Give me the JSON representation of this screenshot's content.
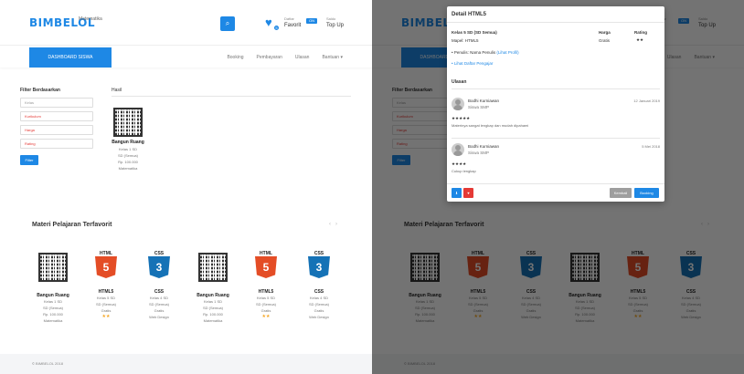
{
  "brand": "BIMBELOL",
  "header": {
    "search_value": "Matematika",
    "fav_label": "Daftar",
    "fav_value": "Favorit",
    "fav_count": "5",
    "toggle_label": "ON",
    "topup_label": "Saldo",
    "topup_value": "Top Up"
  },
  "nav": {
    "dashboard": "DASHBOARD SISWA",
    "items": [
      "Booking",
      "Pembayaran",
      "Ulasan",
      "Bantuan"
    ]
  },
  "filter": {
    "title": "Filter Berdasarkan",
    "fields": [
      "Kelas",
      "Kurikulum",
      "Harga",
      "Rating"
    ],
    "button": "Filter"
  },
  "results": {
    "title": "Hasil",
    "product": {
      "title": "Bangun Ruang",
      "meta": [
        "Kelas 1 SD",
        "SD (Semua)",
        "Rp. 100.000",
        "Matematika"
      ]
    }
  },
  "section": {
    "title": "Materi Pelajaran Terfavorit",
    "cards": [
      {
        "icon": "qr",
        "title": "Bangun Ruang",
        "meta": [
          "Kelas 1 SD",
          "SD (Semua)",
          "Rp. 100.000",
          "Matematika"
        ],
        "stars": ""
      },
      {
        "icon": "html5",
        "label": "HTML",
        "title": "HTML5",
        "meta": [
          "Kelas 5 SD",
          "SD (Semua)",
          "Gratis"
        ],
        "stars": "★★"
      },
      {
        "icon": "css3",
        "label": "CSS",
        "title": "CSS",
        "meta": [
          "Kelas 4 SD",
          "SD (Semua)",
          "Gratis",
          "Web Design"
        ],
        "stars": ""
      },
      {
        "icon": "qr",
        "title": "Bangun Ruang",
        "meta": [
          "Kelas 1 SD",
          "SD (Semua)",
          "Rp. 100.000",
          "Matematika"
        ],
        "stars": ""
      },
      {
        "icon": "html5",
        "label": "HTML",
        "title": "HTML5",
        "meta": [
          "Kelas 5 SD",
          "SD (Semua)",
          "Gratis"
        ],
        "stars": "★★"
      },
      {
        "icon": "css3",
        "label": "CSS",
        "title": "CSS",
        "meta": [
          "Kelas 4 SD",
          "SD (Semua)",
          "Gratis",
          "Web Design"
        ],
        "stars": ""
      }
    ]
  },
  "footer": "© BIMBELOL 2018",
  "modal": {
    "title": "Detail HTML5",
    "kelas": "Kelas 5 SD (SD Semua)",
    "mapel": "Mapel: HTML5",
    "harga_label": "Harga",
    "harga_value": "Gratis",
    "rating_label": "Rating",
    "rating_value": "★★",
    "link1_prefix": "• Penulis: Nama Penulis",
    "link1": "(Lihat Profil)",
    "link2": "• Lihat Daftar Pengajar",
    "ulasan_title": "Ulasan",
    "reviews": [
      {
        "name": "Bodhi Kurniawan",
        "role": "Siswa SMP",
        "date": "12 Januari 2019",
        "stars": "★★★★★",
        "text": "Materinya sangat lengkap dan mudah dipahami"
      },
      {
        "name": "Bodhi Kurniawan",
        "role": "Siswa SMP",
        "date": "5 Mei 2018",
        "stars": "★★★★",
        "text": "Cukup lengkap"
      }
    ],
    "close": "Kembali",
    "booking": "Booking"
  },
  "colors": {
    "accent": "#1e88e5",
    "html5": "#e44d26",
    "css3": "#1572b6",
    "star": "#f5a623",
    "danger": "#e53935"
  }
}
